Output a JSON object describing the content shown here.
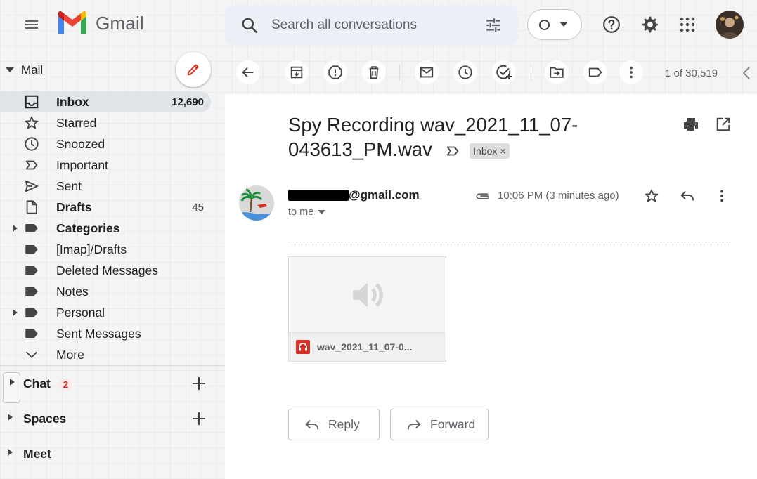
{
  "header": {
    "app_name": "Gmail",
    "search_placeholder": "Search all conversations"
  },
  "sidebar": {
    "mail_label": "Mail",
    "items": [
      {
        "label": "Inbox",
        "count": "12,690",
        "icon": "inbox-icon"
      },
      {
        "label": "Starred",
        "count": "",
        "icon": "star-icon"
      },
      {
        "label": "Snoozed",
        "count": "",
        "icon": "clock-icon"
      },
      {
        "label": "Important",
        "count": "",
        "icon": "important-icon"
      },
      {
        "label": "Sent",
        "count": "",
        "icon": "send-icon"
      },
      {
        "label": "Drafts",
        "count": "45",
        "icon": "draft-icon"
      },
      {
        "label": "Categories",
        "count": "",
        "icon": "label-icon"
      },
      {
        "label": "[Imap]/Drafts",
        "count": "",
        "icon": "label-icon"
      },
      {
        "label": "Deleted Messages",
        "count": "",
        "icon": "label-icon"
      },
      {
        "label": "Notes",
        "count": "",
        "icon": "label-icon"
      },
      {
        "label": "Personal",
        "count": "",
        "icon": "label-icon"
      },
      {
        "label": "Sent Messages",
        "count": "",
        "icon": "label-icon"
      },
      {
        "label": "More",
        "count": "",
        "icon": "chevron-down-icon"
      }
    ],
    "chat_label": "Chat",
    "chat_badge": "2",
    "spaces_label": "Spaces",
    "meet_label": "Meet"
  },
  "toolbar": {
    "pager": "1 of 30,519"
  },
  "message": {
    "subject": "Spy Recording wav_2021_11_07-043613_PM.wav",
    "label_chip": "Inbox",
    "label_chip_close": "×",
    "sender_visible": "@gmail.com",
    "to": "to me",
    "time": "10:06 PM (3 minutes ago)",
    "attachment_name": "wav_2021_11_07-0...",
    "reply_label": "Reply",
    "forward_label": "Forward"
  },
  "colors": {
    "active_bg": "#e0e4e9",
    "search_bg": "#eaf0f6",
    "attachment_fold": "#db4437"
  }
}
